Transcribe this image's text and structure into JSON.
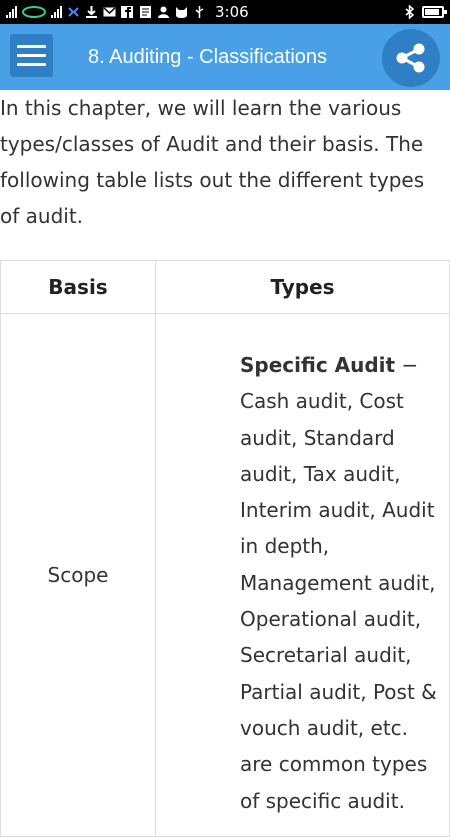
{
  "status_bar": {
    "time": "3:06"
  },
  "app_bar": {
    "title": "8. Auditing - Classifications",
    "menu_icon": "menu-icon",
    "share_icon": "share-icon"
  },
  "intro_text": "In this chapter, we will learn the various types/classes of Audit and their basis. The following table lists out the different types of audit.",
  "table": {
    "headers": [
      "Basis",
      "Types"
    ],
    "rows": [
      {
        "basis": "Scope",
        "types_title": "Specific Audit",
        "types_text": " − Cash audit, Cost audit, Standard audit, Tax audit, Interim audit, Audit in depth, Management audit, Operational audit, Secretarial audit, Partial audit, Post & vouch audit, etc. are common types of specific audit."
      }
    ]
  },
  "colors": {
    "app_bar": "#4aa0e6",
    "app_bar_button": "#2f7fc4",
    "table_border": "#dddddd"
  }
}
